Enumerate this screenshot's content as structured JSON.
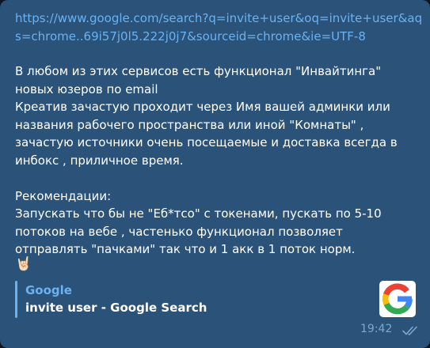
{
  "message": {
    "link": "https://www.google.com/search?q=invite+user&oq=invite+user&aqs=chrome..69i57j0l5.222j0j7&sourceid=chrome&ie=UTF-8",
    "body": "В любом из этих сервисов есть функционал \"Инвайтинга\" новых юзеров по email\nКреатив зачастую проходит через Имя вашей админки или названия рабочего пространства или иной \"Комнаты\" ,\nзачастую источники очень посещаемые и доставка всегда в инбокс , приличное время.\n\nРекомендации:\nЗапускать что бы не \"Еб*тсо\" с токенами, пускать по 5-10 потоков на вебе , частенько функционал позволяет отправлять \"пачками\" так что и 1 акк в 1 поток норм.",
    "emoji": "🤘🏻",
    "preview": {
      "site_name": "Google",
      "title": "invite user - Google Search",
      "thumbnail_icon": "google-g-logo"
    },
    "time": "19:42",
    "status": "read",
    "status_icon": "double-check-icon"
  },
  "colors": {
    "bubble_bg": "#2b5278",
    "link": "#6ab2f2",
    "text": "#ffffff",
    "meta": "#7da8d3"
  }
}
